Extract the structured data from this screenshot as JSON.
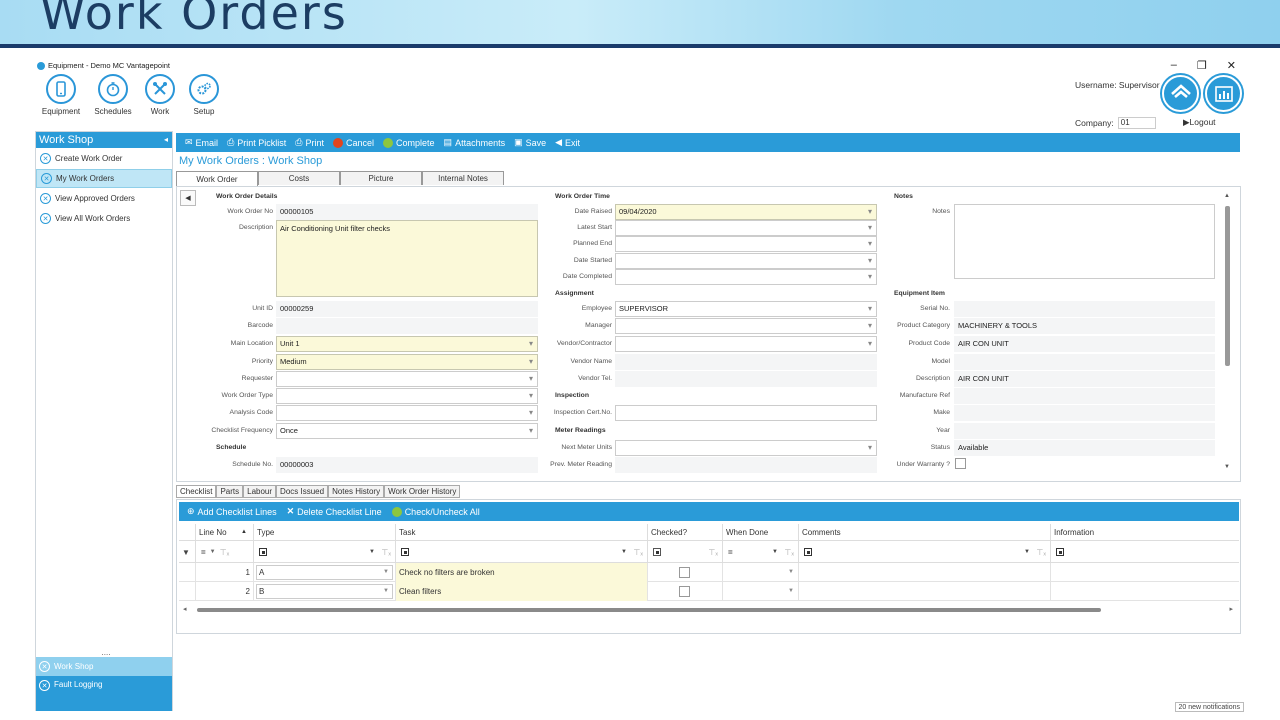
{
  "banner": {
    "title": "Work Orders"
  },
  "app": {
    "window_title": "Equipment - Demo MC Vantagepoint",
    "nav": [
      {
        "label": "Equipment",
        "icon": "phone-icon"
      },
      {
        "label": "Schedules",
        "icon": "stopwatch-icon"
      },
      {
        "label": "Work",
        "icon": "tools-icon"
      },
      {
        "label": "Setup",
        "icon": "gears-icon"
      }
    ],
    "window_controls": {
      "minimize": "–",
      "restore": "❐",
      "close": "✕"
    },
    "username_label": "Username: Supervisor",
    "company_label": "Company:",
    "company_value": "01",
    "logout": "▶Logout"
  },
  "sidebar": {
    "title": "Work Shop",
    "items": [
      "Create Work Order",
      "My Work Orders",
      "View Approved Orders",
      "View All Work Orders"
    ],
    "selected_index": 1,
    "dots": "....",
    "bottom_items": [
      "Work Shop",
      "Fault Logging"
    ]
  },
  "toolbar": {
    "email": "Email",
    "print_picklist": "Print Picklist",
    "print": "Print",
    "cancel": "Cancel",
    "complete": "Complete",
    "attachments": "Attachments",
    "save": "Save",
    "exit": "Exit"
  },
  "page_title": "My Work Orders : Work Shop",
  "tabs": [
    "Work Order",
    "Costs",
    "Picture",
    "Internal Notes"
  ],
  "form": {
    "details_header": "Work Order Details",
    "work_order_no_label": "Work Order No",
    "work_order_no": "00000105",
    "description_label": "Description",
    "description": "Air Conditioning Unit filter checks",
    "unit_id_label": "Unit ID",
    "unit_id": "00000259",
    "barcode_label": "Barcode",
    "barcode": "",
    "main_location_label": "Main Location",
    "main_location": "Unit 1",
    "priority_label": "Priority",
    "priority": "Medium",
    "requester_label": "Requester",
    "work_order_type_label": "Work Order Type",
    "analysis_code_label": "Analysis Code",
    "checklist_frequency_label": "Checklist Frequency",
    "checklist_frequency": "Once",
    "schedule_header": "Schedule",
    "schedule_no_label": "Schedule No.",
    "schedule_no": "00000003",
    "time_header": "Work Order Time",
    "date_raised_label": "Date Raised",
    "date_raised": "09/04/2020",
    "latest_start_label": "Latest Start",
    "planned_end_label": "Planned End",
    "date_started_label": "Date Started",
    "date_completed_label": "Date Completed",
    "assignment_header": "Assignment",
    "employee_label": "Employee",
    "employee": "SUPERVISOR",
    "manager_label": "Manager",
    "vendor_label": "Vendor/Contractor",
    "vendor_name_label": "Vendor Name",
    "vendor_tel_label": "Vendor Tel.",
    "inspection_header": "Inspection",
    "inspection_cert_label": "Inspection Cert.No.",
    "meter_header": "Meter Readings",
    "next_meter_label": "Next Meter Units",
    "prev_meter_label": "Prev. Meter Reading",
    "notes_header": "Notes",
    "notes_label": "Notes",
    "equipment_header": "Equipment Item",
    "serial_label": "Serial No.",
    "product_category_label": "Product Category",
    "product_category": "MACHINERY & TOOLS",
    "product_code_label": "Product Code",
    "product_code": "AIR CON UNIT",
    "model_label": "Model",
    "description2_label": "Description",
    "description2": "AIR CON UNIT",
    "manufacture_ref_label": "Manufacture Ref",
    "make_label": "Make",
    "year_label": "Year",
    "status_label": "Status",
    "status": "Available",
    "under_warranty_label": "Under Warranty ?"
  },
  "bottom_tabs": [
    "Checklist",
    "Parts",
    "Labour",
    "Docs Issued",
    "Notes History",
    "Work Order History"
  ],
  "grid": {
    "add": "Add Checklist Lines",
    "delete": "Delete Checklist Line",
    "check": "Check/Uncheck All",
    "columns": [
      "Line No",
      "Type",
      "Task",
      "Checked?",
      "When Done",
      "Comments",
      "Information"
    ],
    "rows": [
      {
        "line_no": "1",
        "type": "A",
        "task": "Check no filters are broken"
      },
      {
        "line_no": "2",
        "type": "B",
        "task": "Clean filters"
      }
    ]
  },
  "notifications": "20 new notifications",
  "colors": {
    "accent": "#2a9bd8",
    "banner_text": "#1c3d63",
    "field_yellow": "#fbf9d9"
  }
}
